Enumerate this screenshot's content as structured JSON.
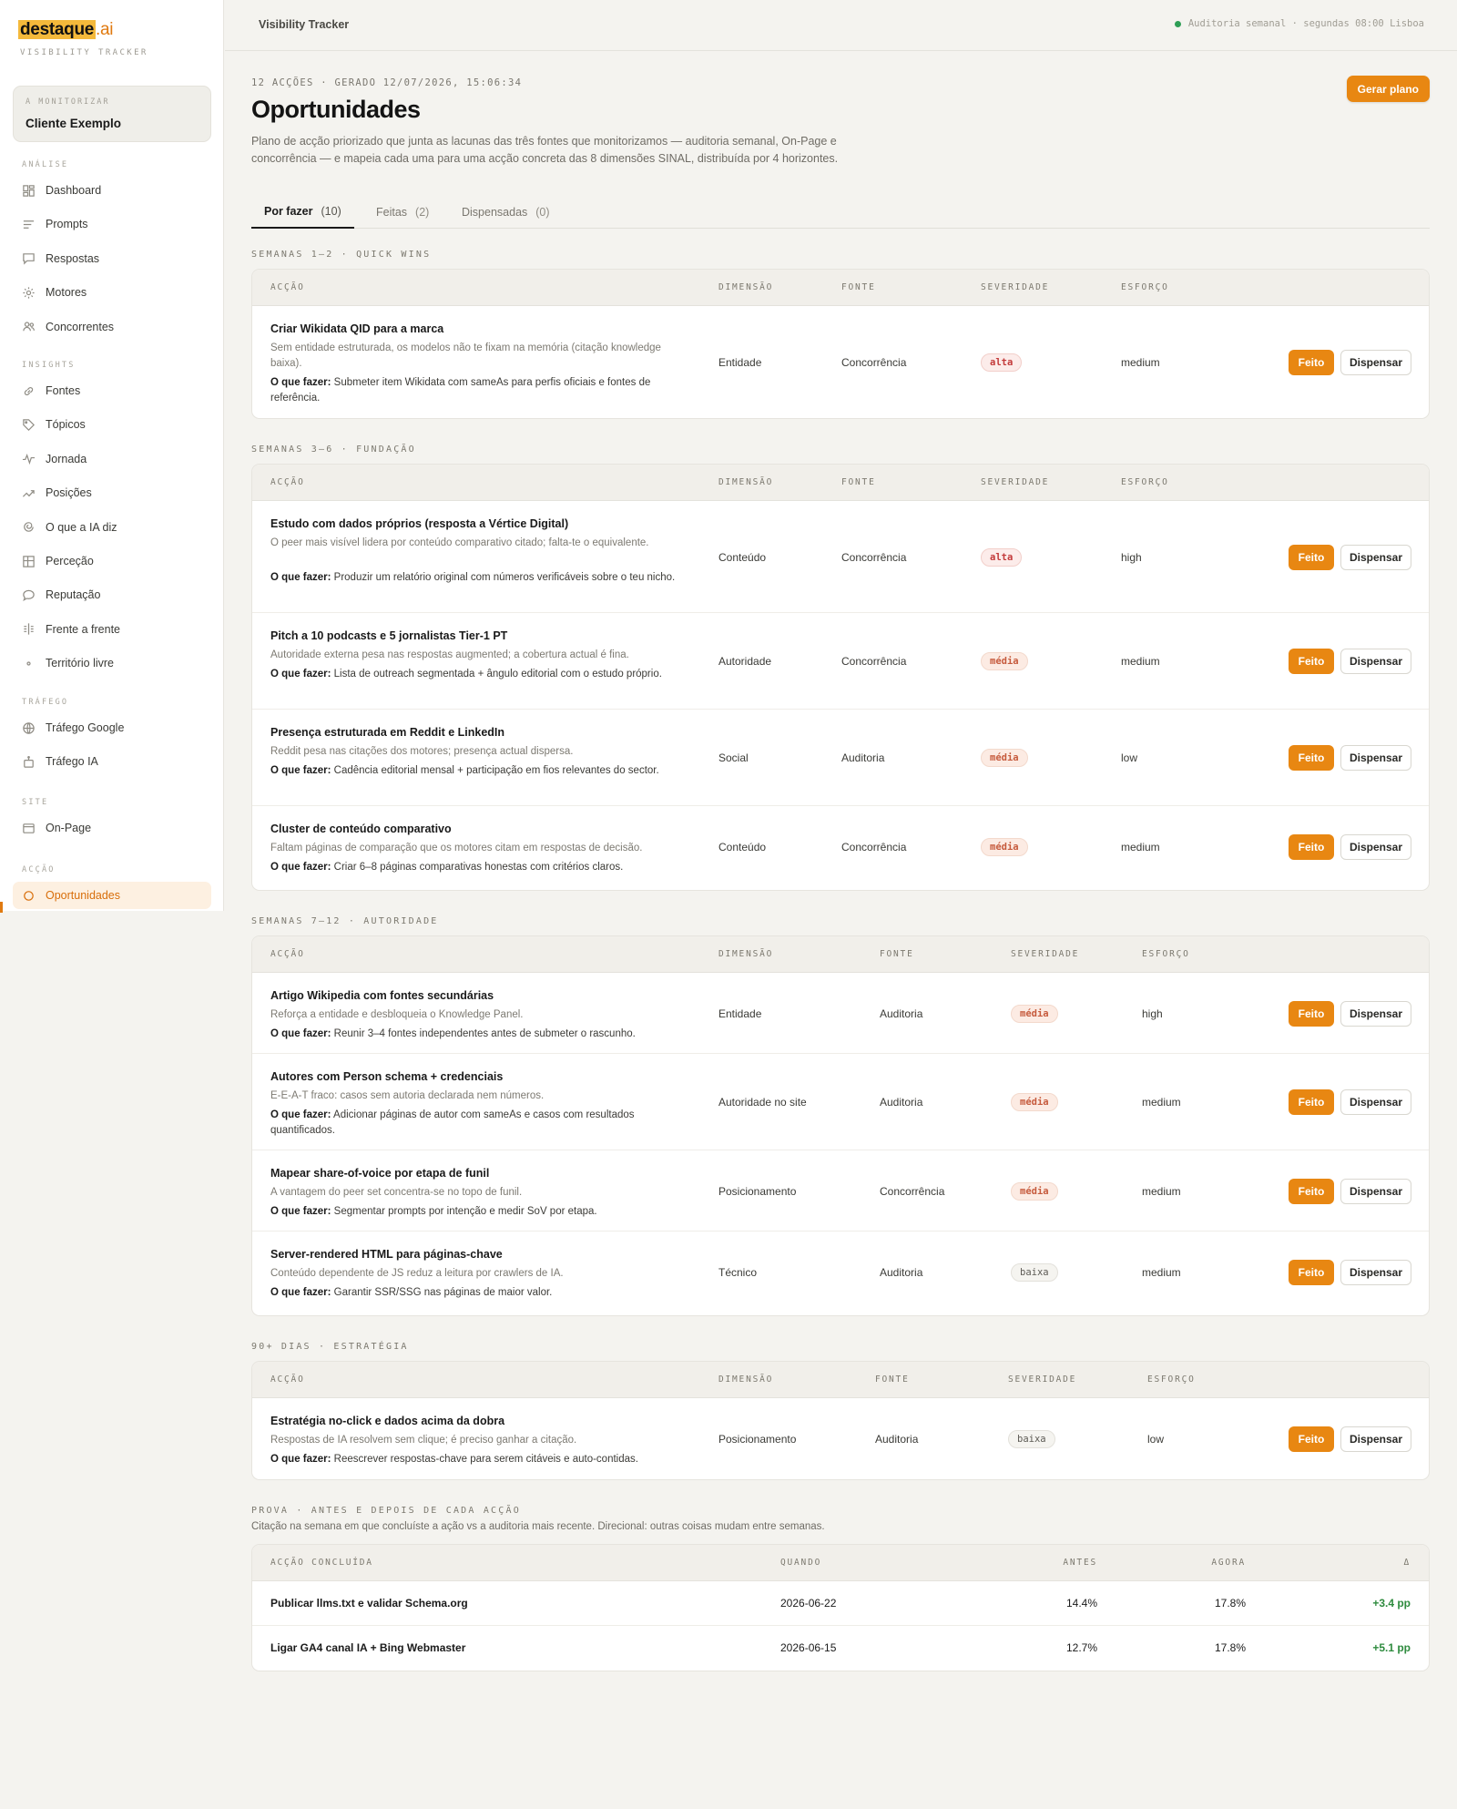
{
  "brand": {
    "name": "destaque",
    "tld": ".ai",
    "subtitle": "VISIBILITY TRACKER"
  },
  "client": {
    "label": "A MONITORIZAR",
    "name": "Cliente Exemplo"
  },
  "nav": {
    "sections": [
      {
        "label": "ANÁLISE",
        "items": [
          {
            "label": "Dashboard",
            "icon": "dashboard-icon"
          },
          {
            "label": "Prompts",
            "icon": "lines-icon"
          },
          {
            "label": "Respostas",
            "icon": "chat-icon"
          },
          {
            "label": "Motores",
            "icon": "engine-icon"
          },
          {
            "label": "Concorrentes",
            "icon": "users-icon"
          }
        ]
      },
      {
        "label": "INSIGHTS",
        "items": [
          {
            "label": "Fontes",
            "icon": "link-icon"
          },
          {
            "label": "Tópicos",
            "icon": "tag-icon"
          },
          {
            "label": "Jornada",
            "icon": "pulse-icon"
          },
          {
            "label": "Posições",
            "icon": "trend-icon"
          },
          {
            "label": "O que a IA diz",
            "icon": "spiral-icon"
          },
          {
            "label": "Perceção",
            "icon": "grid-icon"
          },
          {
            "label": "Reputação",
            "icon": "bubble-icon"
          },
          {
            "label": "Frente a frente",
            "icon": "compare-icon"
          },
          {
            "label": "Território livre",
            "icon": "dot-icon"
          }
        ]
      },
      {
        "label": "TRÁFEGO",
        "items": [
          {
            "label": "Tráfego Google",
            "icon": "globe-icon"
          },
          {
            "label": "Tráfego IA",
            "icon": "bot-icon"
          }
        ]
      },
      {
        "label": "SITE",
        "items": [
          {
            "label": "On-Page",
            "icon": "page-icon"
          }
        ]
      },
      {
        "label": "ACÇÃO",
        "items": [
          {
            "label": "Oportunidades",
            "icon": "target-icon"
          }
        ]
      }
    ]
  },
  "topbar": {
    "title": "Visibility Tracker",
    "status": "Auditoria semanal · segundas 08:00 Lisboa",
    "status_color": "#2e9e55"
  },
  "page": {
    "meta": "12 ACÇÕES · GERADO 12/07/2026, 15:06:34",
    "title": "Oportunidades",
    "description": "Plano de acção priorizado que junta as lacunas das três fontes que monitorizamos — auditoria semanal, On-Page e concorrência — e mapeia cada uma para uma acção concreta das 8 dimensões SINAL, distribuída por 4 horizontes.",
    "generate_label": "Gerar plano",
    "accent": "#e88712"
  },
  "tabs": [
    {
      "label": "Por fazer",
      "count": "(10)"
    },
    {
      "label": "Feitas",
      "count": "(2)"
    },
    {
      "label": "Dispensadas",
      "count": "(0)"
    }
  ],
  "columns": {
    "acao": "ACÇÃO",
    "dimensao": "DIMENSÃO",
    "fonte": "FONTE",
    "severidade": "SEVERIDADE",
    "esforco": "ESFORÇO"
  },
  "todo_prefix": "O que fazer:",
  "buttons": {
    "done": "Feito",
    "dismiss": "Dispensar"
  },
  "groups": [
    {
      "label": "SEMANAS 1–2 · QUICK WINS",
      "items": [
        {
          "title": "Criar Wikidata QID para a marca",
          "desc": "Sem entidade estruturada, os modelos não te fixam na memória (citação knowledge baixa).",
          "todo": "Submeter item Wikidata com sameAs para perfis oficiais e fontes de referência.",
          "dimensao": "Entidade",
          "fonte": "Concorrência",
          "severidade": "alta",
          "esforco": "medium"
        }
      ]
    },
    {
      "label": "SEMANAS 3–6 · FUNDAÇÃO",
      "items": [
        {
          "title": "Estudo com dados próprios (resposta a Vértice Digital)",
          "desc": "O peer mais visível lidera por conteúdo comparativo citado; falta-te o equivalente.",
          "todo": "Produzir um relatório original com números verificáveis sobre o teu nicho.",
          "dimensao": "Conteúdo",
          "fonte": "Concorrência",
          "severidade": "alta",
          "esforco": "high"
        },
        {
          "title": "Pitch a 10 podcasts e 5 jornalistas Tier-1 PT",
          "desc": "Autoridade externa pesa nas respostas augmented; a cobertura actual é fina.",
          "todo": "Lista de outreach segmentada + ângulo editorial com o estudo próprio.",
          "dimensao": "Autoridade",
          "fonte": "Concorrência",
          "severidade": "média",
          "esforco": "medium"
        },
        {
          "title": "Presença estruturada em Reddit e LinkedIn",
          "desc": "Reddit pesa nas citações dos motores; presença actual dispersa.",
          "todo": "Cadência editorial mensal + participação em fios relevantes do sector.",
          "dimensao": "Social",
          "fonte": "Auditoria",
          "severidade": "média",
          "esforco": "low"
        },
        {
          "title": "Cluster de conteúdo comparativo",
          "desc": "Faltam páginas de comparação que os motores citam em respostas de decisão.",
          "todo": "Criar 6–8 páginas comparativas honestas com critérios claros.",
          "dimensao": "Conteúdo",
          "fonte": "Concorrência",
          "severidade": "média",
          "esforco": "medium"
        }
      ]
    },
    {
      "label": "SEMANAS 7–12 · AUTORIDADE",
      "items": [
        {
          "title": "Artigo Wikipedia com fontes secundárias",
          "desc": "Reforça a entidade e desbloqueia o Knowledge Panel.",
          "todo": "Reunir 3–4 fontes independentes antes de submeter o rascunho.",
          "dimensao": "Entidade",
          "fonte": "Auditoria",
          "severidade": "média",
          "esforco": "high"
        },
        {
          "title": "Autores com Person schema + credenciais",
          "desc": "E-E-A-T fraco: casos sem autoria declarada nem números.",
          "todo": "Adicionar páginas de autor com sameAs e casos com resultados quantificados.",
          "dimensao": "Autoridade no site",
          "fonte": "Auditoria",
          "severidade": "média",
          "esforco": "medium"
        },
        {
          "title": "Mapear share-of-voice por etapa de funil",
          "desc": "A vantagem do peer set concentra-se no topo de funil.",
          "todo": "Segmentar prompts por intenção e medir SoV por etapa.",
          "dimensao": "Posicionamento",
          "fonte": "Concorrência",
          "severidade": "média",
          "esforco": "medium"
        },
        {
          "title": "Server-rendered HTML para páginas-chave",
          "desc": "Conteúdo dependente de JS reduz a leitura por crawlers de IA.",
          "todo": "Garantir SSR/SSG nas páginas de maior valor.",
          "dimensao": "Técnico",
          "fonte": "Auditoria",
          "severidade": "baixa",
          "esforco": "medium"
        }
      ]
    },
    {
      "label": "90+ DIAS · ESTRATÉGIA",
      "items": [
        {
          "title": "Estratégia no-click e dados acima da dobra",
          "desc": "Respostas de IA resolvem sem clique; é preciso ganhar a citação.",
          "todo": "Reescrever respostas-chave para serem citáveis e auto-contidas.",
          "dimensao": "Posicionamento",
          "fonte": "Auditoria",
          "severidade": "baixa",
          "esforco": "low"
        }
      ]
    }
  ],
  "proof": {
    "label": "PROVA · ANTES E DEPOIS DE CADA ACÇÃO",
    "subtitle": "Citação na semana em que concluíste a ação vs a auditoria mais recente. Direcional: outras coisas mudam entre semanas.",
    "columns": {
      "acao": "ACÇÃO CONCLUÍDA",
      "quando": "QUANDO",
      "antes": "ANTES",
      "agora": "AGORA",
      "delta": "Δ"
    },
    "rows": [
      {
        "acao": "Publicar llms.txt e validar Schema.org",
        "quando": "2026-06-22",
        "antes": "14.4%",
        "agora": "17.8%",
        "delta": "+3.4 pp"
      },
      {
        "acao": "Ligar GA4 canal IA + Bing Webmaster",
        "quando": "2026-06-15",
        "antes": "12.7%",
        "agora": "17.8%",
        "delta": "+5.1 pp"
      }
    ],
    "delta_color": "#2e8b3e"
  }
}
